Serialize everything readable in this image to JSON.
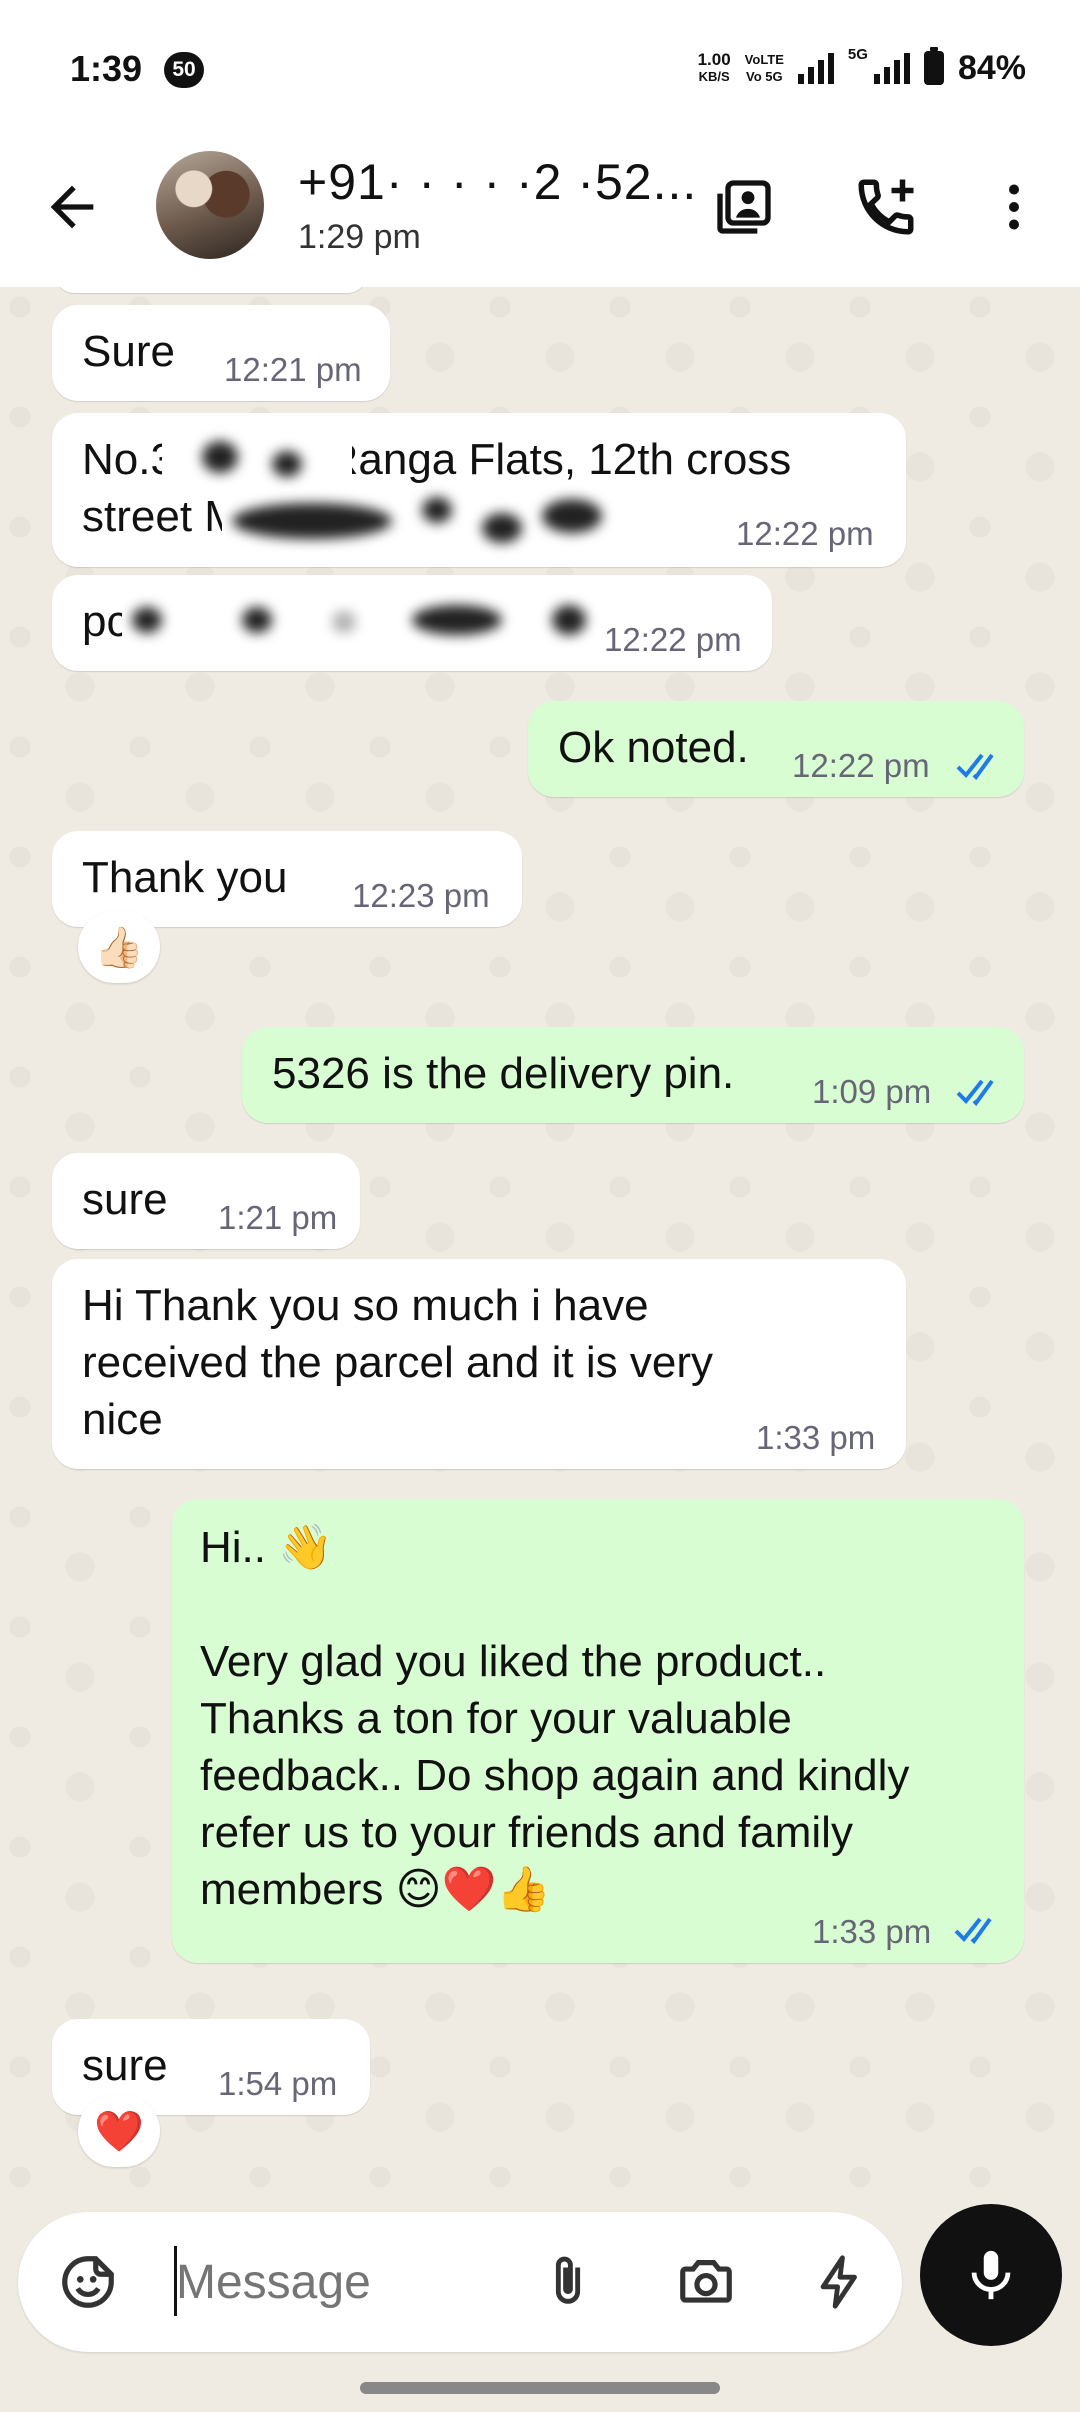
{
  "status_bar": {
    "time": "1:39",
    "notification_count": "50",
    "net_speed": "1.00",
    "net_unit": "KB/S",
    "volte_top": "VoLTE",
    "volte_bottom": "Vo 5G",
    "network": "5G",
    "battery": "84%"
  },
  "header": {
    "contact_name": "+91· · · · ·2 ·52...",
    "last_seen": "1:29 pm",
    "icons": [
      "back-arrow-icon",
      "contact-card-icon",
      "add-call-icon",
      "more-vert-icon"
    ]
  },
  "messages": [
    {
      "dir": "in",
      "text": "Sure",
      "time": "12:21 pm"
    },
    {
      "dir": "in",
      "text": "No.323B on Ranga Flats, 12th cross\nstreet M",
      "time": "12:22 pm"
    },
    {
      "dir": "in",
      "text": "pc",
      "time": "12:22 pm"
    },
    {
      "dir": "out",
      "text": "Ok noted.",
      "time": "12:22 pm",
      "status": "read"
    },
    {
      "dir": "in",
      "text": "Thank you",
      "time": "12:23 pm",
      "reaction": "👍🏻"
    },
    {
      "dir": "out",
      "text": "5326 is the delivery pin.",
      "time": "1:09 pm",
      "status": "read"
    },
    {
      "dir": "in",
      "text": "sure",
      "time": "1:21 pm"
    },
    {
      "dir": "in",
      "text": "Hi Thank you so much i have\nreceived the parcel and it is very\nnice",
      "time": "1:33 pm"
    },
    {
      "dir": "out",
      "text": "Hi.. 👋\n\nVery glad you liked the product..\nThanks a ton for your valuable\nfeedback.. Do shop again and kindly\nrefer us to your friends and family\nmembers 😊❤️👍",
      "time": "1:33 pm",
      "status": "read"
    },
    {
      "dir": "in",
      "text": "sure",
      "time": "1:54 pm",
      "reaction": "❤️"
    }
  ],
  "composer": {
    "placeholder": "Message",
    "value": "",
    "icons": [
      "sticker-icon",
      "attach-icon",
      "camera-icon",
      "quick-reply-icon",
      "mic-icon"
    ]
  },
  "colors": {
    "incoming_bubble": "#ffffff",
    "outgoing_bubble": "#d9fdd3",
    "chat_background": "#efeae2",
    "read_ticks": "#1f7aec"
  }
}
